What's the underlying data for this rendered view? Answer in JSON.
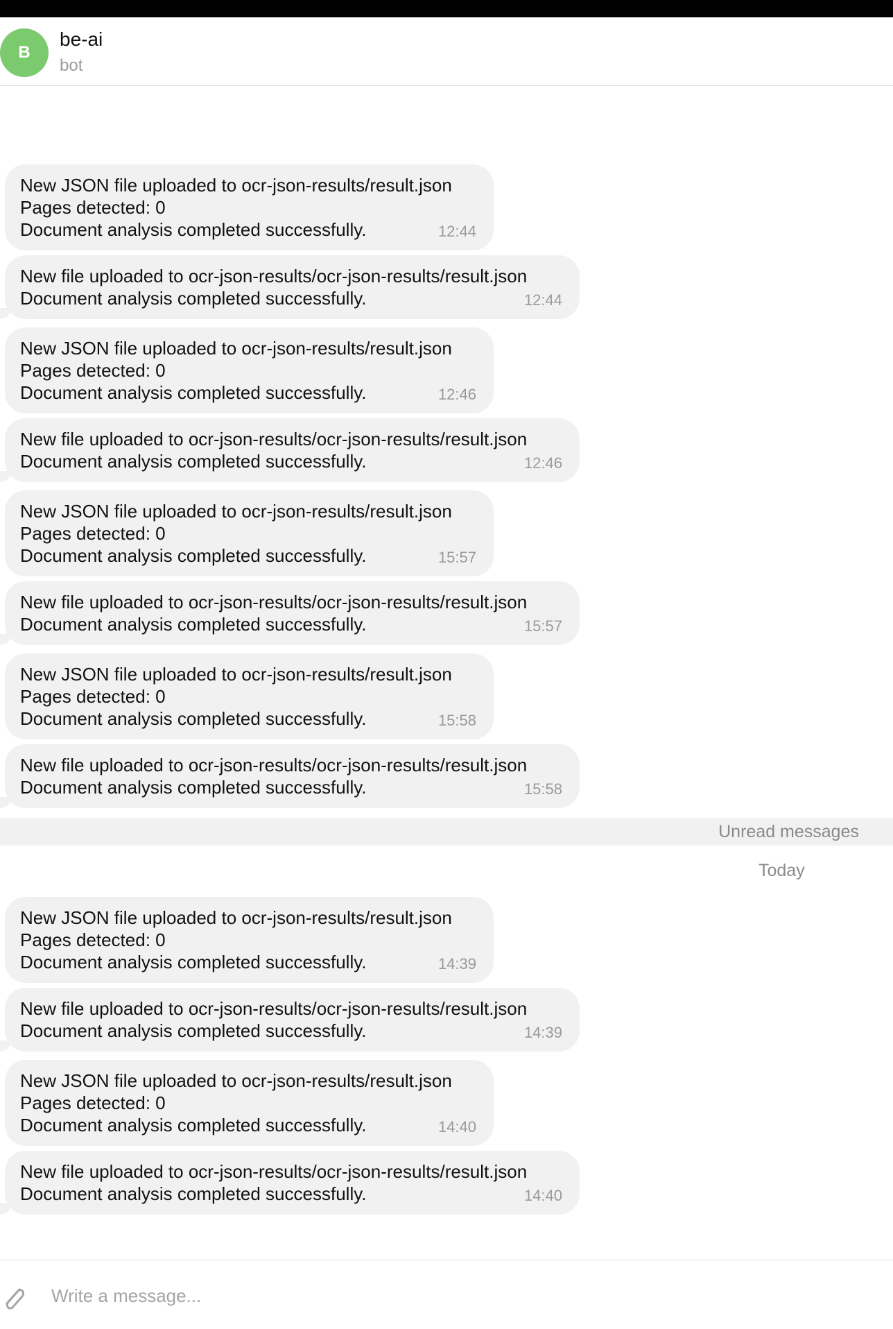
{
  "chat": {
    "avatar_letter": "B",
    "title": "be-ai",
    "subtitle": "bot",
    "avatar_color": "#7cca6e"
  },
  "messages_before": [
    {
      "lines": [
        "New JSON file uploaded to ocr-json-results/result.json",
        "Pages detected: 0",
        "Document analysis completed successfully."
      ],
      "time": "12:44"
    },
    {
      "lines": [
        "New file uploaded to ocr-json-results/ocr-json-results/result.json",
        "Document analysis completed successfully."
      ],
      "time": "12:44"
    },
    {
      "lines": [
        "New JSON file uploaded to ocr-json-results/result.json",
        "Pages detected: 0",
        "Document analysis completed successfully."
      ],
      "time": "12:46"
    },
    {
      "lines": [
        "New file uploaded to ocr-json-results/ocr-json-results/result.json",
        "Document analysis completed successfully."
      ],
      "time": "12:46"
    },
    {
      "lines": [
        "New JSON file uploaded to ocr-json-results/result.json",
        "Pages detected: 0",
        "Document analysis completed successfully."
      ],
      "time": "15:57"
    },
    {
      "lines": [
        "New file uploaded to ocr-json-results/ocr-json-results/result.json",
        "Document analysis completed successfully."
      ],
      "time": "15:57"
    },
    {
      "lines": [
        "New JSON file uploaded to ocr-json-results/result.json",
        "Pages detected: 0",
        "Document analysis completed successfully."
      ],
      "time": "15:58"
    },
    {
      "lines": [
        "New file uploaded to ocr-json-results/ocr-json-results/result.json",
        "Document analysis completed successfully."
      ],
      "time": "15:58"
    }
  ],
  "unread_label": "Unread messages",
  "date_label": "Today",
  "messages_after": [
    {
      "lines": [
        "New JSON file uploaded to ocr-json-results/result.json",
        "Pages detected: 0",
        "Document analysis completed successfully."
      ],
      "time": "14:39"
    },
    {
      "lines": [
        "New file uploaded to ocr-json-results/ocr-json-results/result.json",
        "Document analysis completed successfully."
      ],
      "time": "14:39"
    },
    {
      "lines": [
        "New JSON file uploaded to ocr-json-results/result.json",
        "Pages detected: 0",
        "Document analysis completed successfully."
      ],
      "time": "14:40"
    },
    {
      "lines": [
        "New file uploaded to ocr-json-results/ocr-json-results/result.json",
        "Document analysis completed successfully."
      ],
      "time": "14:40"
    }
  ],
  "composer": {
    "placeholder": "Write a message...",
    "attach_icon": "paperclip-icon"
  }
}
